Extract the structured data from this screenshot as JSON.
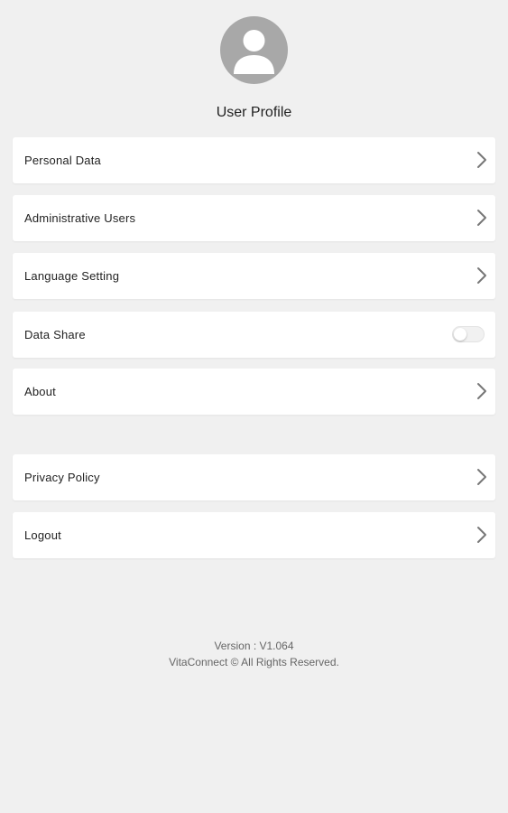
{
  "header": {
    "avatar_icon": "user-avatar-icon",
    "title": "User Profile"
  },
  "menu": {
    "items": [
      {
        "label": "Personal Data",
        "icon": "chevron-right-icon"
      },
      {
        "label": "Administrative Users",
        "icon": "chevron-right-icon"
      },
      {
        "label": "Language Setting",
        "icon": "chevron-right-icon"
      },
      {
        "label": "Data Share",
        "control": "toggle",
        "toggle_on": false
      },
      {
        "label": "About",
        "icon": "chevron-right-icon"
      }
    ],
    "secondary_items": [
      {
        "label": "Privacy Policy",
        "icon": "chevron-right-icon"
      },
      {
        "label": "Logout",
        "icon": "chevron-right-icon"
      }
    ]
  },
  "footer": {
    "version": "Version : V1.064",
    "copyright": "VitaConnect © All Rights Reserved."
  },
  "colors": {
    "background": "#f0f0f0",
    "card": "#ffffff",
    "avatar": "#a8a8a8",
    "chevron": "#777777"
  }
}
